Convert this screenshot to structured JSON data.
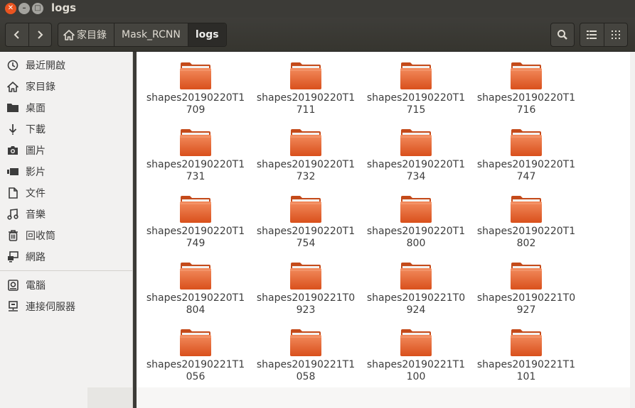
{
  "window": {
    "title": "logs"
  },
  "toolbar": {
    "path": [
      "家目錄",
      "Mask_RCNN",
      "logs"
    ]
  },
  "sidebar": {
    "items": [
      {
        "label": "最近開啟",
        "icon": "clock-icon"
      },
      {
        "label": "家目錄",
        "icon": "home-icon"
      },
      {
        "label": "桌面",
        "icon": "folder-icon"
      },
      {
        "label": "下載",
        "icon": "download-icon"
      },
      {
        "label": "圖片",
        "icon": "camera-icon"
      },
      {
        "label": "影片",
        "icon": "video-icon"
      },
      {
        "label": "文件",
        "icon": "document-icon"
      },
      {
        "label": "音樂",
        "icon": "music-icon"
      },
      {
        "label": "回收筒",
        "icon": "trash-icon"
      },
      {
        "label": "網路",
        "icon": "network-icon"
      }
    ],
    "devices": [
      {
        "label": "電腦",
        "icon": "computer-icon"
      },
      {
        "label": "連接伺服器",
        "icon": "server-icon"
      }
    ]
  },
  "files": [
    [
      "shapes20190220T1",
      "709"
    ],
    [
      "shapes20190220T1",
      "711"
    ],
    [
      "shapes20190220T1",
      "715"
    ],
    [
      "shapes20190220T1",
      "716"
    ],
    [
      "shapes20190220T1",
      "731"
    ],
    [
      "shapes20190220T1",
      "732"
    ],
    [
      "shapes20190220T1",
      "734"
    ],
    [
      "shapes20190220T1",
      "747"
    ],
    [
      "shapes20190220T1",
      "749"
    ],
    [
      "shapes20190220T1",
      "754"
    ],
    [
      "shapes20190220T1",
      "800"
    ],
    [
      "shapes20190220T1",
      "802"
    ],
    [
      "shapes20190220T1",
      "804"
    ],
    [
      "shapes20190221T0",
      "923"
    ],
    [
      "shapes20190221T0",
      "924"
    ],
    [
      "shapes20190221T0",
      "927"
    ],
    [
      "shapes20190221T1",
      "056"
    ],
    [
      "shapes20190221T1",
      "058"
    ],
    [
      "shapes20190221T1",
      "100"
    ],
    [
      "shapes20190221T1",
      "101"
    ]
  ],
  "colors": {
    "accent": "#e95420",
    "folder": "#e05a22",
    "folder_light": "#f0764a"
  }
}
